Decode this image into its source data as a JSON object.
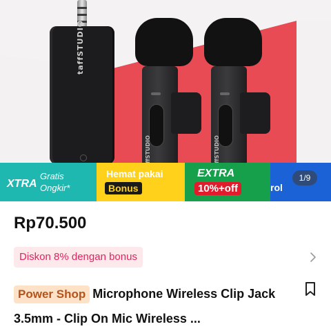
{
  "hero": {
    "receiver_brand": "taffSTUDIO",
    "mic_brand": "taffSTUDIO"
  },
  "promo": {
    "xtra_big": "XTRA",
    "xtra_line1": "Gratis",
    "xtra_line2": "Ongkir*",
    "hemat_line1": "Hemat pakai",
    "hemat_line2": "Bonus",
    "extra_line1": "EXTRA",
    "extra_line2": "10%+off",
    "ctrl_text": "rol"
  },
  "gallery": {
    "counter": "1/9"
  },
  "product": {
    "price": "Rp70.500",
    "discount": "Diskon 8% dengan bonus",
    "shop_badge": "Power Shop",
    "title": "Microphone Wireless Clip Jack 3.5mm - Clip On Mic Wireless  ..."
  },
  "colors": {
    "discount_text": "#e0245e",
    "discount_bg": "#fde9ec",
    "xtra": "#1fb8b0",
    "hemat": "#ffd11a",
    "extra": "#17a04c",
    "ctrl": "#1b62d6"
  },
  "icons": {
    "chevron": "chevron-right-icon",
    "bookmark": "bookmark-icon"
  }
}
